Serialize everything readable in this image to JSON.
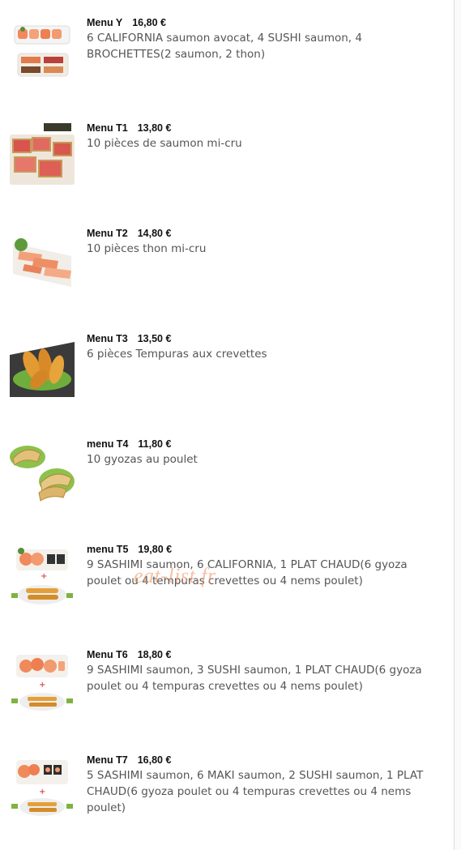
{
  "watermark": "eat-list.fr",
  "items": [
    {
      "name": "Menu Y",
      "price": "16,80 €",
      "desc": "6 CALIFORNIA saumon avocat, 4 SUSHI saumon, 4 BROCHETTES(2 saumon, 2 thon)"
    },
    {
      "name": "Menu T1",
      "price": "13,80 €",
      "desc": "10 pièces de saumon mi-cru"
    },
    {
      "name": "Menu T2",
      "price": "14,80 €",
      "desc": "10 pièces thon mi-cru"
    },
    {
      "name": "Menu T3",
      "price": "13,50 €",
      "desc": "6 pièces Tempuras aux crevettes"
    },
    {
      "name": "menu T4",
      "price": "11,80 €",
      "desc": "10 gyozas au poulet"
    },
    {
      "name": "menu T5",
      "price": "19,80 €",
      "desc": "9 SASHIMI saumon, 6 CALIFORNIA, 1 PLAT CHAUD(6 gyoza poulet ou 4 tempuras crevettes ou 4 nems poulet)"
    },
    {
      "name": "Menu T6",
      "price": "18,80 €",
      "desc": "9 SASHIMI saumon, 3 SUSHI saumon, 1 PLAT CHAUD(6 gyoza poulet ou 4 tempuras crevettes ou 4 nems poulet)"
    },
    {
      "name": "Menu T7",
      "price": "16,80 €",
      "desc": "5 SASHIMI saumon, 6 MAKI saumon, 2 SUSHI saumon, 1 PLAT CHAUD(6 gyoza poulet ou 4 tempuras crevettes ou 4 nems poulet)"
    }
  ]
}
